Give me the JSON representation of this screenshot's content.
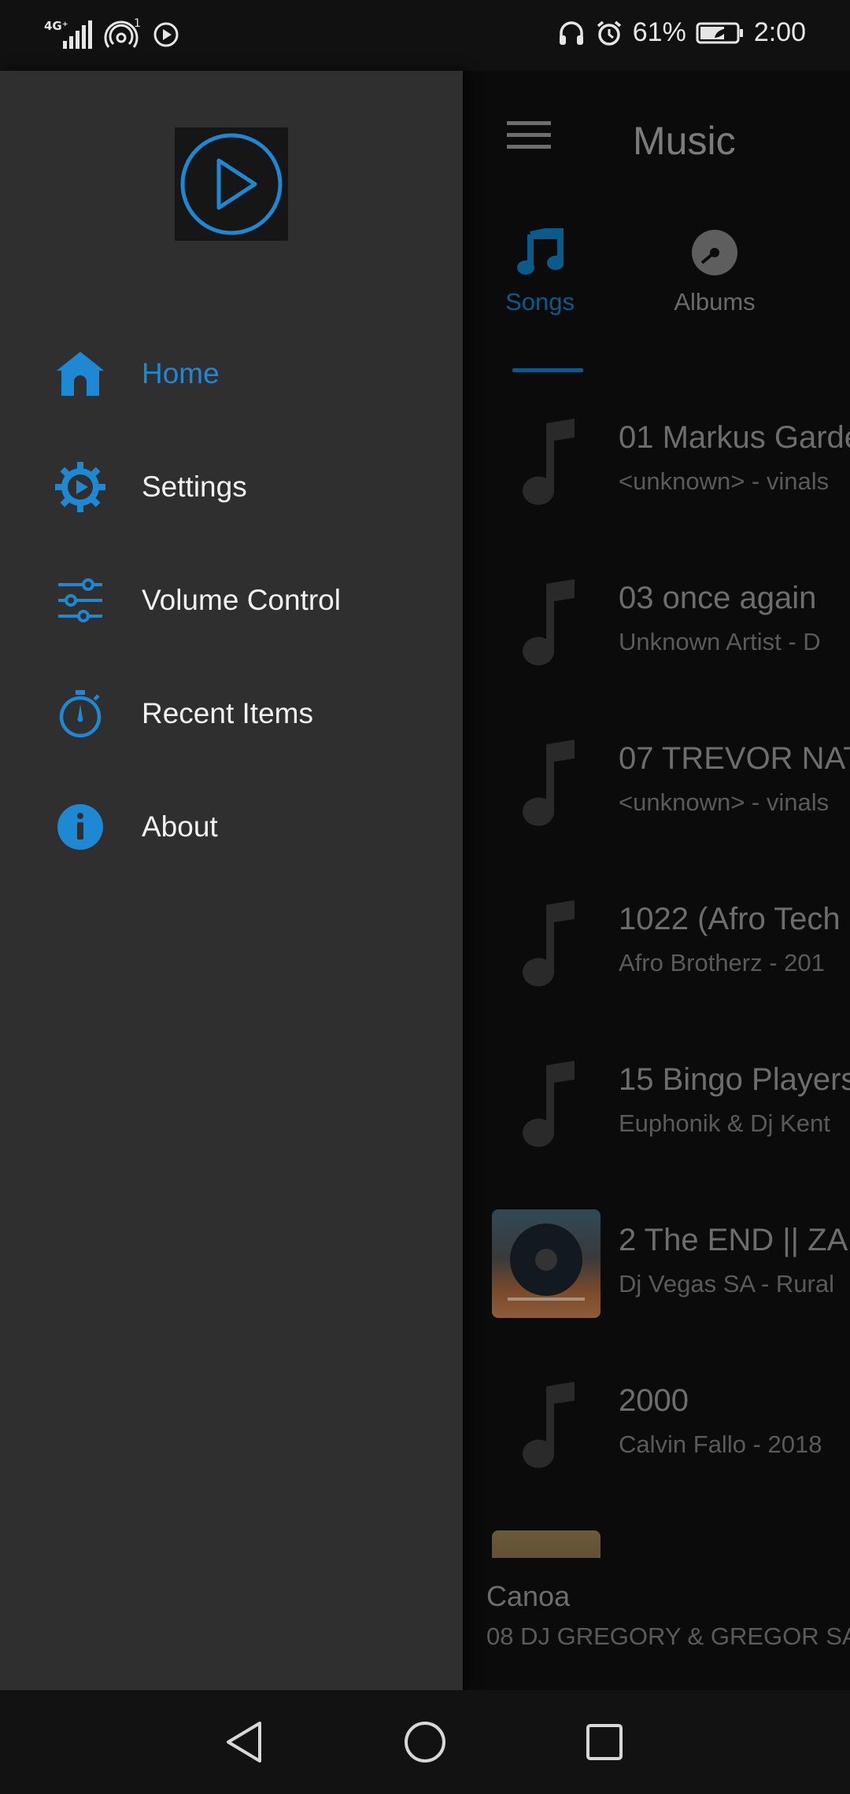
{
  "status_bar": {
    "network": "4G⁺",
    "hotspot_count": "1",
    "battery_percent": "61%",
    "time": "2:00"
  },
  "app": {
    "title": "Music",
    "tabs": [
      {
        "label": "Songs",
        "icon": "music-note-icon",
        "active": true
      },
      {
        "label": "Albums",
        "icon": "disc-icon",
        "active": false
      }
    ],
    "songs": [
      {
        "title": "01 Markus Garde",
        "subtitle": "<unknown> - vinals",
        "thumb": "music-note-icon"
      },
      {
        "title": "03 once again",
        "subtitle": "Unknown Artist - D",
        "thumb": "music-note-icon"
      },
      {
        "title": "07 TREVOR NAT",
        "subtitle": "<unknown> - vinals",
        "thumb": "music-note-icon"
      },
      {
        "title": "1022 (Afro Tech",
        "subtitle": "Afro Brotherz - 201",
        "thumb": "music-note-icon"
      },
      {
        "title": "15 Bingo Players",
        "subtitle": "Euphonik & Dj Kent",
        "thumb": "music-note-icon"
      },
      {
        "title": "2 The END || ZA",
        "subtitle": "Dj Vegas SA - Rural",
        "thumb": "album-art"
      },
      {
        "title": "2000",
        "subtitle": "Calvin Fallo - 2018",
        "thumb": "music-note-icon"
      }
    ],
    "now_playing": {
      "title": "Canoa",
      "subtitle": "08 DJ GREGORY & GREGOR SA"
    }
  },
  "drawer": {
    "items": [
      {
        "label": "Home",
        "icon": "home-icon",
        "active": true
      },
      {
        "label": "Settings",
        "icon": "gear-icon",
        "active": false
      },
      {
        "label": "Volume Control",
        "icon": "sliders-icon",
        "active": false
      },
      {
        "label": "Recent Items",
        "icon": "stopwatch-icon",
        "active": false
      },
      {
        "label": "About",
        "icon": "info-icon",
        "active": false
      }
    ]
  },
  "colors": {
    "accent": "#1e88d2",
    "drawer_bg": "#2f2f30",
    "app_bg": "#0b0b0b",
    "status_bg": "#111111"
  }
}
